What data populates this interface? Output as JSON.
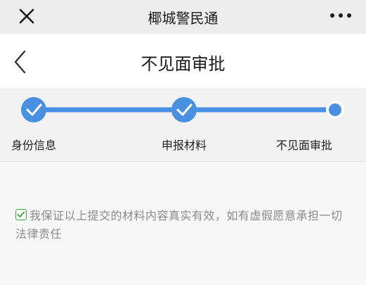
{
  "topbar": {
    "title": "椰城警民通",
    "close_icon": "close-icon",
    "more_icon": "more-icon"
  },
  "header": {
    "title": "不见面审批",
    "back_icon": "back-chevron-icon"
  },
  "steps": [
    {
      "label": "身份信息",
      "status": "completed"
    },
    {
      "label": "申报材料",
      "status": "completed"
    },
    {
      "label": "不见面审批",
      "status": "current"
    }
  ],
  "agreement": {
    "checked": true,
    "text": "我保证以上提交的材料内容真实有效，如有虚假愿意承担一切法律责任"
  },
  "colors": {
    "accent": "#4a90e2",
    "check": "#3aa83a"
  }
}
